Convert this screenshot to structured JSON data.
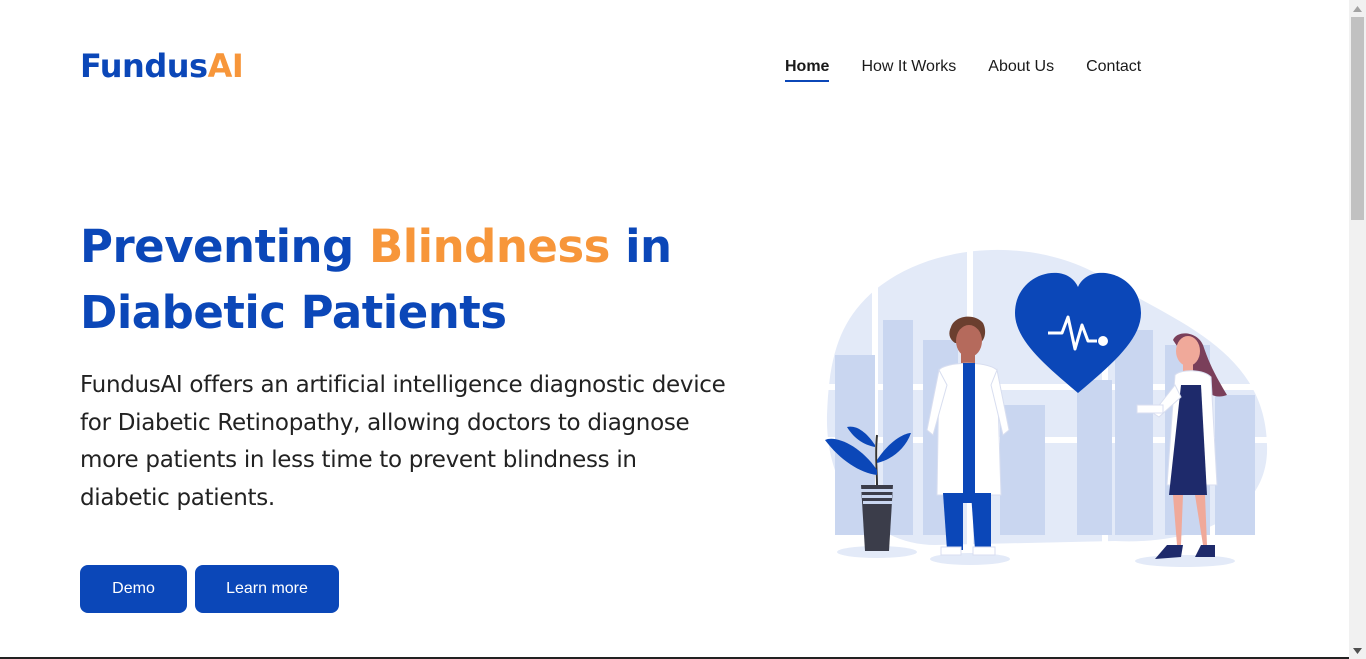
{
  "brand": {
    "part1": "Fundus",
    "part2": "AI"
  },
  "nav": {
    "items": [
      {
        "label": "Home",
        "active": true
      },
      {
        "label": "How It Works",
        "active": false
      },
      {
        "label": "About Us",
        "active": false
      },
      {
        "label": "Contact",
        "active": false
      }
    ]
  },
  "hero": {
    "title_part1": "Preventing ",
    "title_accent": "Blindness",
    "title_part2": " in Diabetic Patients",
    "description": "FundusAI offers an artificial intelligence diagnostic device for Diabetic Retinopathy, allowing doctors to diagnose more patients in less time to prevent blindness in diabetic patients.",
    "buttons": {
      "demo": "Demo",
      "learn_more": "Learn more"
    }
  },
  "illustration": {
    "subject": "doctors-with-heart-illustration"
  },
  "colors": {
    "brand_blue": "#0b47b8",
    "brand_orange": "#f7963a",
    "illustration_light": "#e3eaf8",
    "illustration_mid": "#c9d6f0"
  }
}
